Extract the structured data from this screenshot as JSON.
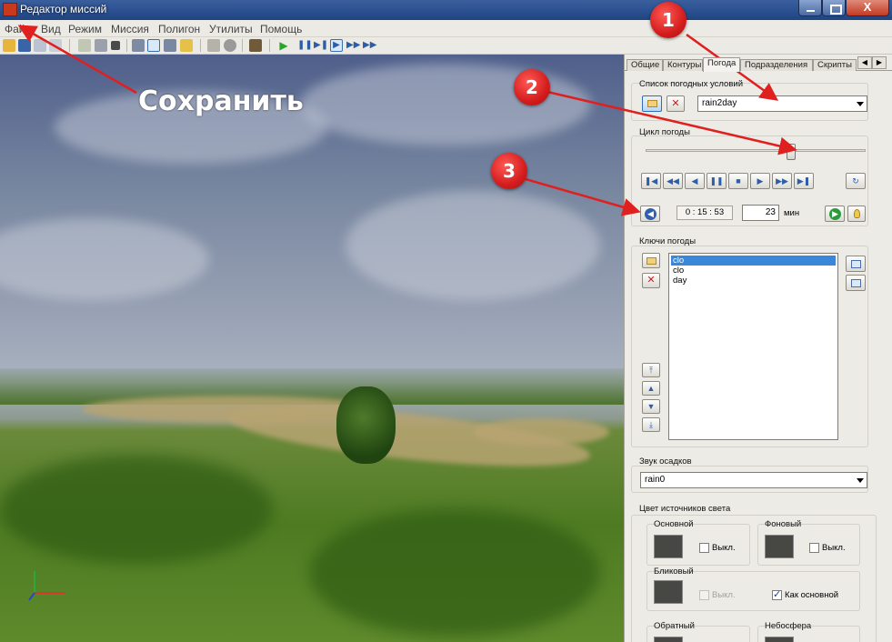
{
  "window": {
    "title": "Редактор миссий",
    "close_label": "X"
  },
  "menu": [
    "Файл",
    "Вид",
    "Режим",
    "Миссия",
    "Полигон",
    "Утилиты",
    "Помощь"
  ],
  "tabs": [
    "Общие",
    "Контуры",
    "Погода",
    "Подразделения",
    "Скрипты"
  ],
  "active_tab": "Погода",
  "weather_list": {
    "label": "Список погодных условий",
    "selected": "rain2day"
  },
  "weather_cycle": {
    "label": "Цикл погоды",
    "slider_fraction": 0.66,
    "time": "0 : 15 : 53",
    "minutes_value": "23",
    "minutes_unit": "мин"
  },
  "weather_keys": {
    "label": "Ключи погоды",
    "items": [
      "clo",
      "clo",
      "day"
    ],
    "selected_index": 0
  },
  "precip_sound": {
    "label": "Звук осадков",
    "selected": "rain0"
  },
  "light_colors": {
    "label": "Цвет источников света",
    "main": {
      "label": "Основной",
      "off_label": "Выкл."
    },
    "ambient": {
      "label": "Фоновый",
      "off_label": "Выкл."
    },
    "specular": {
      "label": "Бликовый",
      "off_label": "Выкл.",
      "as_main_label": "Как основной"
    },
    "back": {
      "label": "Обратный"
    },
    "sky": {
      "label": "Небосфера"
    }
  },
  "annotations": {
    "save_label": "Сохранить",
    "markers": [
      "1",
      "2",
      "3"
    ]
  },
  "colors": {
    "marker_red": "#d41d1d",
    "selection_blue": "#3a86d8",
    "swatch": "#474744"
  }
}
